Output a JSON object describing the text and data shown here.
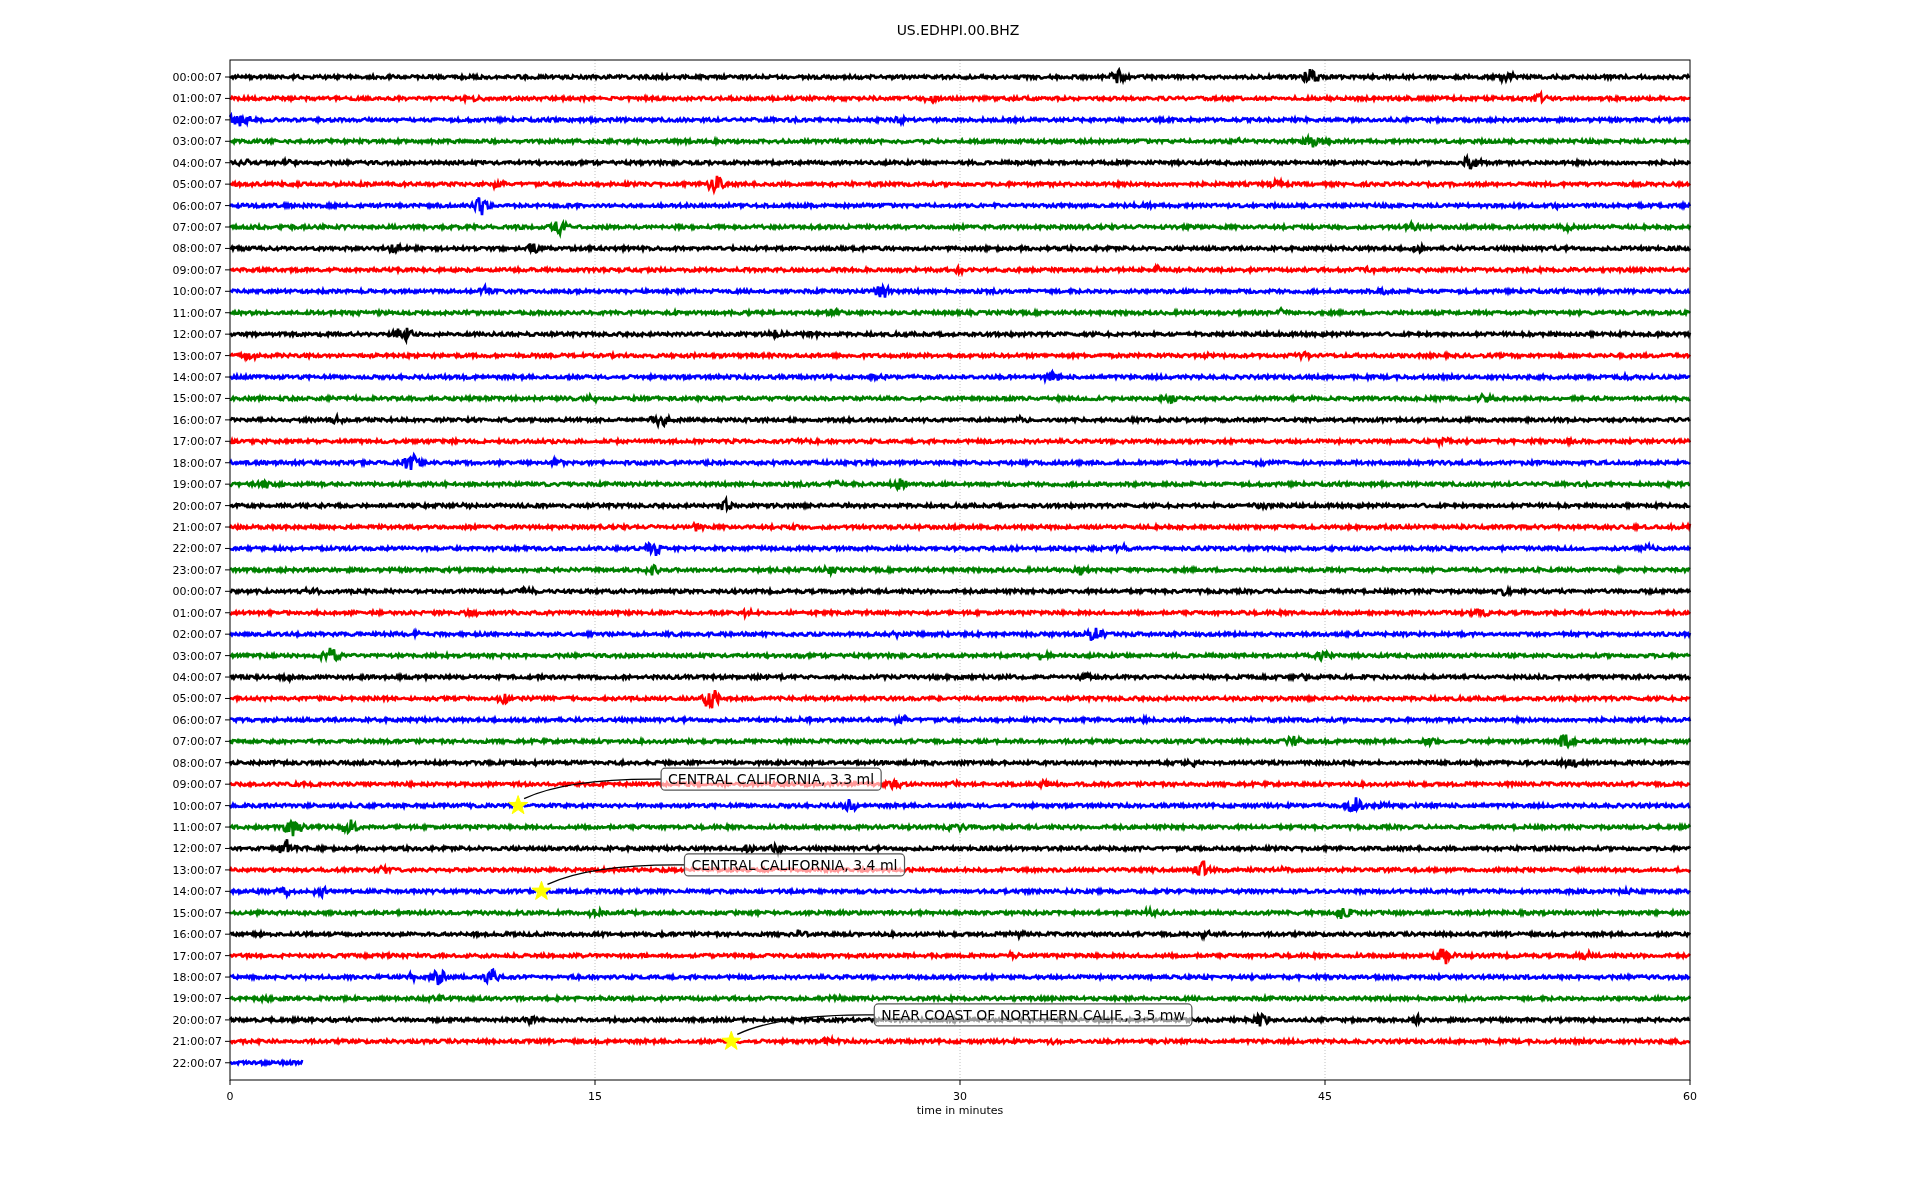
{
  "title": "US.EDHPI.00.BHZ",
  "plot": {
    "x_label": "time in minutes",
    "x_ticks": [
      "0",
      "15",
      "30",
      "45",
      "60"
    ],
    "rows": [
      {
        "label": "00:00:07",
        "color": "#000000",
        "level": 1
      },
      {
        "label": "01:00:07",
        "color": "#ff0000",
        "level": 1
      },
      {
        "label": "02:00:07",
        "color": "#0000ff",
        "level": 1
      },
      {
        "label": "03:00:07",
        "color": "#008000",
        "level": 1
      },
      {
        "label": "04:00:07",
        "color": "#000000",
        "level": 1
      },
      {
        "label": "05:00:07",
        "color": "#ff0000",
        "level": 1
      },
      {
        "label": "06:00:07",
        "color": "#0000ff",
        "level": 1
      },
      {
        "label": "07:00:07",
        "color": "#008000",
        "level": 1
      },
      {
        "label": "08:00:07",
        "color": "#000000",
        "level": 1
      },
      {
        "label": "09:00:07",
        "color": "#ff0000",
        "level": 1
      },
      {
        "label": "10:00:07",
        "color": "#0000ff",
        "level": 1
      },
      {
        "label": "11:00:07",
        "color": "#008000",
        "level": 1
      },
      {
        "label": "12:00:07",
        "color": "#000000",
        "level": 1
      },
      {
        "label": "13:00:07",
        "color": "#ff0000",
        "level": 1
      },
      {
        "label": "14:00:07",
        "color": "#0000ff",
        "level": 1
      },
      {
        "label": "15:00:07",
        "color": "#008000",
        "level": 1
      },
      {
        "label": "16:00:07",
        "color": "#000000",
        "level": 1
      },
      {
        "label": "17:00:07",
        "color": "#ff0000",
        "level": 1
      },
      {
        "label": "18:00:07",
        "color": "#0000ff",
        "level": 1
      },
      {
        "label": "19:00:07",
        "color": "#008000",
        "level": 1
      },
      {
        "label": "20:00:07",
        "color": "#000000",
        "level": 1
      },
      {
        "label": "21:00:07",
        "color": "#ff0000",
        "level": 1
      },
      {
        "label": "22:00:07",
        "color": "#0000ff",
        "level": 1
      },
      {
        "label": "23:00:07",
        "color": "#008000",
        "level": 1
      },
      {
        "label": "00:00:07",
        "color": "#000000",
        "level": 1
      },
      {
        "label": "01:00:07",
        "color": "#ff0000",
        "level": 1
      },
      {
        "label": "02:00:07",
        "color": "#0000ff",
        "level": 1
      },
      {
        "label": "03:00:07",
        "color": "#008000",
        "level": 1
      },
      {
        "label": "04:00:07",
        "color": "#000000",
        "level": 1
      },
      {
        "label": "05:00:07",
        "color": "#ff0000",
        "level": 1
      },
      {
        "label": "06:00:07",
        "color": "#0000ff",
        "level": 1
      },
      {
        "label": "07:00:07",
        "color": "#008000",
        "level": 1
      },
      {
        "label": "08:00:07",
        "color": "#000000",
        "level": 1
      },
      {
        "label": "09:00:07",
        "color": "#ff0000",
        "level": 1
      },
      {
        "label": "10:00:07",
        "color": "#0000ff",
        "level": 1,
        "event": "CENTRAL CALIFORNIA, 3.3 ml"
      },
      {
        "label": "11:00:07",
        "color": "#008000",
        "level": 1
      },
      {
        "label": "12:00:07",
        "color": "#000000",
        "level": 1
      },
      {
        "label": "13:00:07",
        "color": "#ff0000",
        "level": 1
      },
      {
        "label": "14:00:07",
        "color": "#0000ff",
        "level": 1,
        "event": "CENTRAL CALIFORNIA, 3.4 ml"
      },
      {
        "label": "15:00:07",
        "color": "#008000",
        "level": 1
      },
      {
        "label": "16:00:07",
        "color": "#000000",
        "level": 1
      },
      {
        "label": "17:00:07",
        "color": "#ff0000",
        "level": 1
      },
      {
        "label": "18:00:07",
        "color": "#0000ff",
        "level": 1
      },
      {
        "label": "19:00:07",
        "color": "#008000",
        "level": 1
      },
      {
        "label": "20:00:07",
        "color": "#000000",
        "level": 1
      },
      {
        "label": "21:00:07",
        "color": "#ff0000",
        "level": 1,
        "event": "NEAR COAST OF NORTHERN CALIF., 3.5 mw"
      },
      {
        "label": "22:00:07",
        "color": "#0000ff",
        "level": 0.05
      }
    ]
  }
}
